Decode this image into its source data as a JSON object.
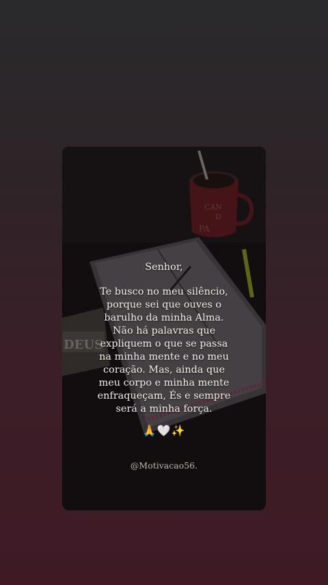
{
  "story": {
    "greeting": "Senhor,",
    "lines": [
      "Te busco no meu silêncio,",
      "porque sei que ouves o",
      "barulho da minha Alma.",
      "Não há palavras que",
      "expliquem o que se passa",
      "na minha mente e no meu",
      "coração. Mas, ainda que",
      "meu corpo e minha mente",
      "enfraqueçam, És e sempre",
      "será a minha força."
    ],
    "emojis": "🙏🤍✨",
    "handle": "@Motivacao56."
  },
  "background_art": {
    "mug_text_1": "CAN",
    "mug_text_2": "D",
    "mug_text_3": "PA",
    "book_text": "DEUS"
  },
  "colors": {
    "page_top": "#2a2a2c",
    "page_bottom": "#3f1a25",
    "text": "#f3efea",
    "handle": "#bdb6b0",
    "mug_red": "#6e1f24",
    "highlighter": "#b8c42a"
  }
}
